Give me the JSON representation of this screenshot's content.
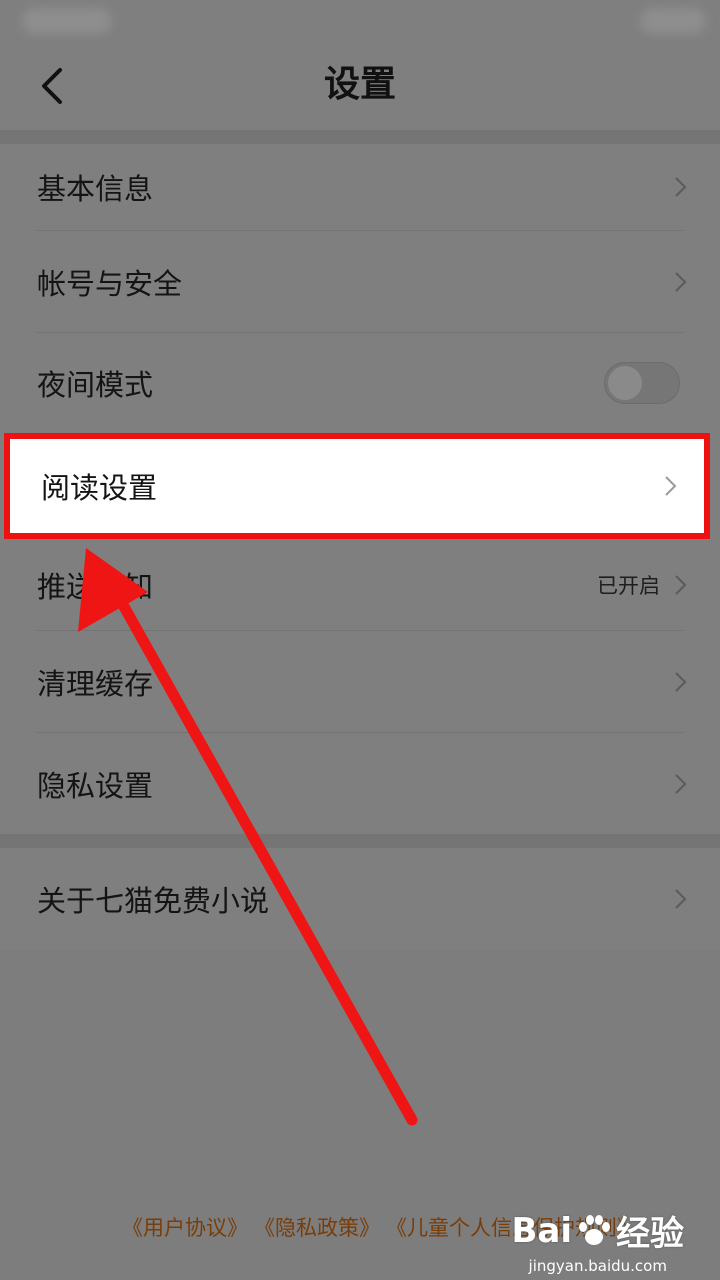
{
  "header": {
    "title": "设置"
  },
  "settings_group_1": {
    "items": [
      {
        "label": "基本信息"
      },
      {
        "label": "帐号与安全"
      },
      {
        "label": "夜间模式"
      },
      {
        "label": "阅读设置"
      },
      {
        "label": "推送通知",
        "value": "已开启"
      },
      {
        "label": "清理缓存"
      },
      {
        "label": "隐私设置"
      }
    ]
  },
  "settings_group_2": {
    "items": [
      {
        "label": "关于七猫免费小说"
      }
    ]
  },
  "footer": {
    "links": [
      "《用户协议》",
      "《隐私政策》",
      "《儿童个人信息保护规则》"
    ]
  },
  "watermark": {
    "logo": "Bai",
    "logo_suffix": "经验",
    "url": "jingyan.baidu.com"
  },
  "colors": {
    "highlight_border": "#ee1111",
    "annotation_arrow": "#f01515",
    "footer_link": "#7a3d08"
  }
}
